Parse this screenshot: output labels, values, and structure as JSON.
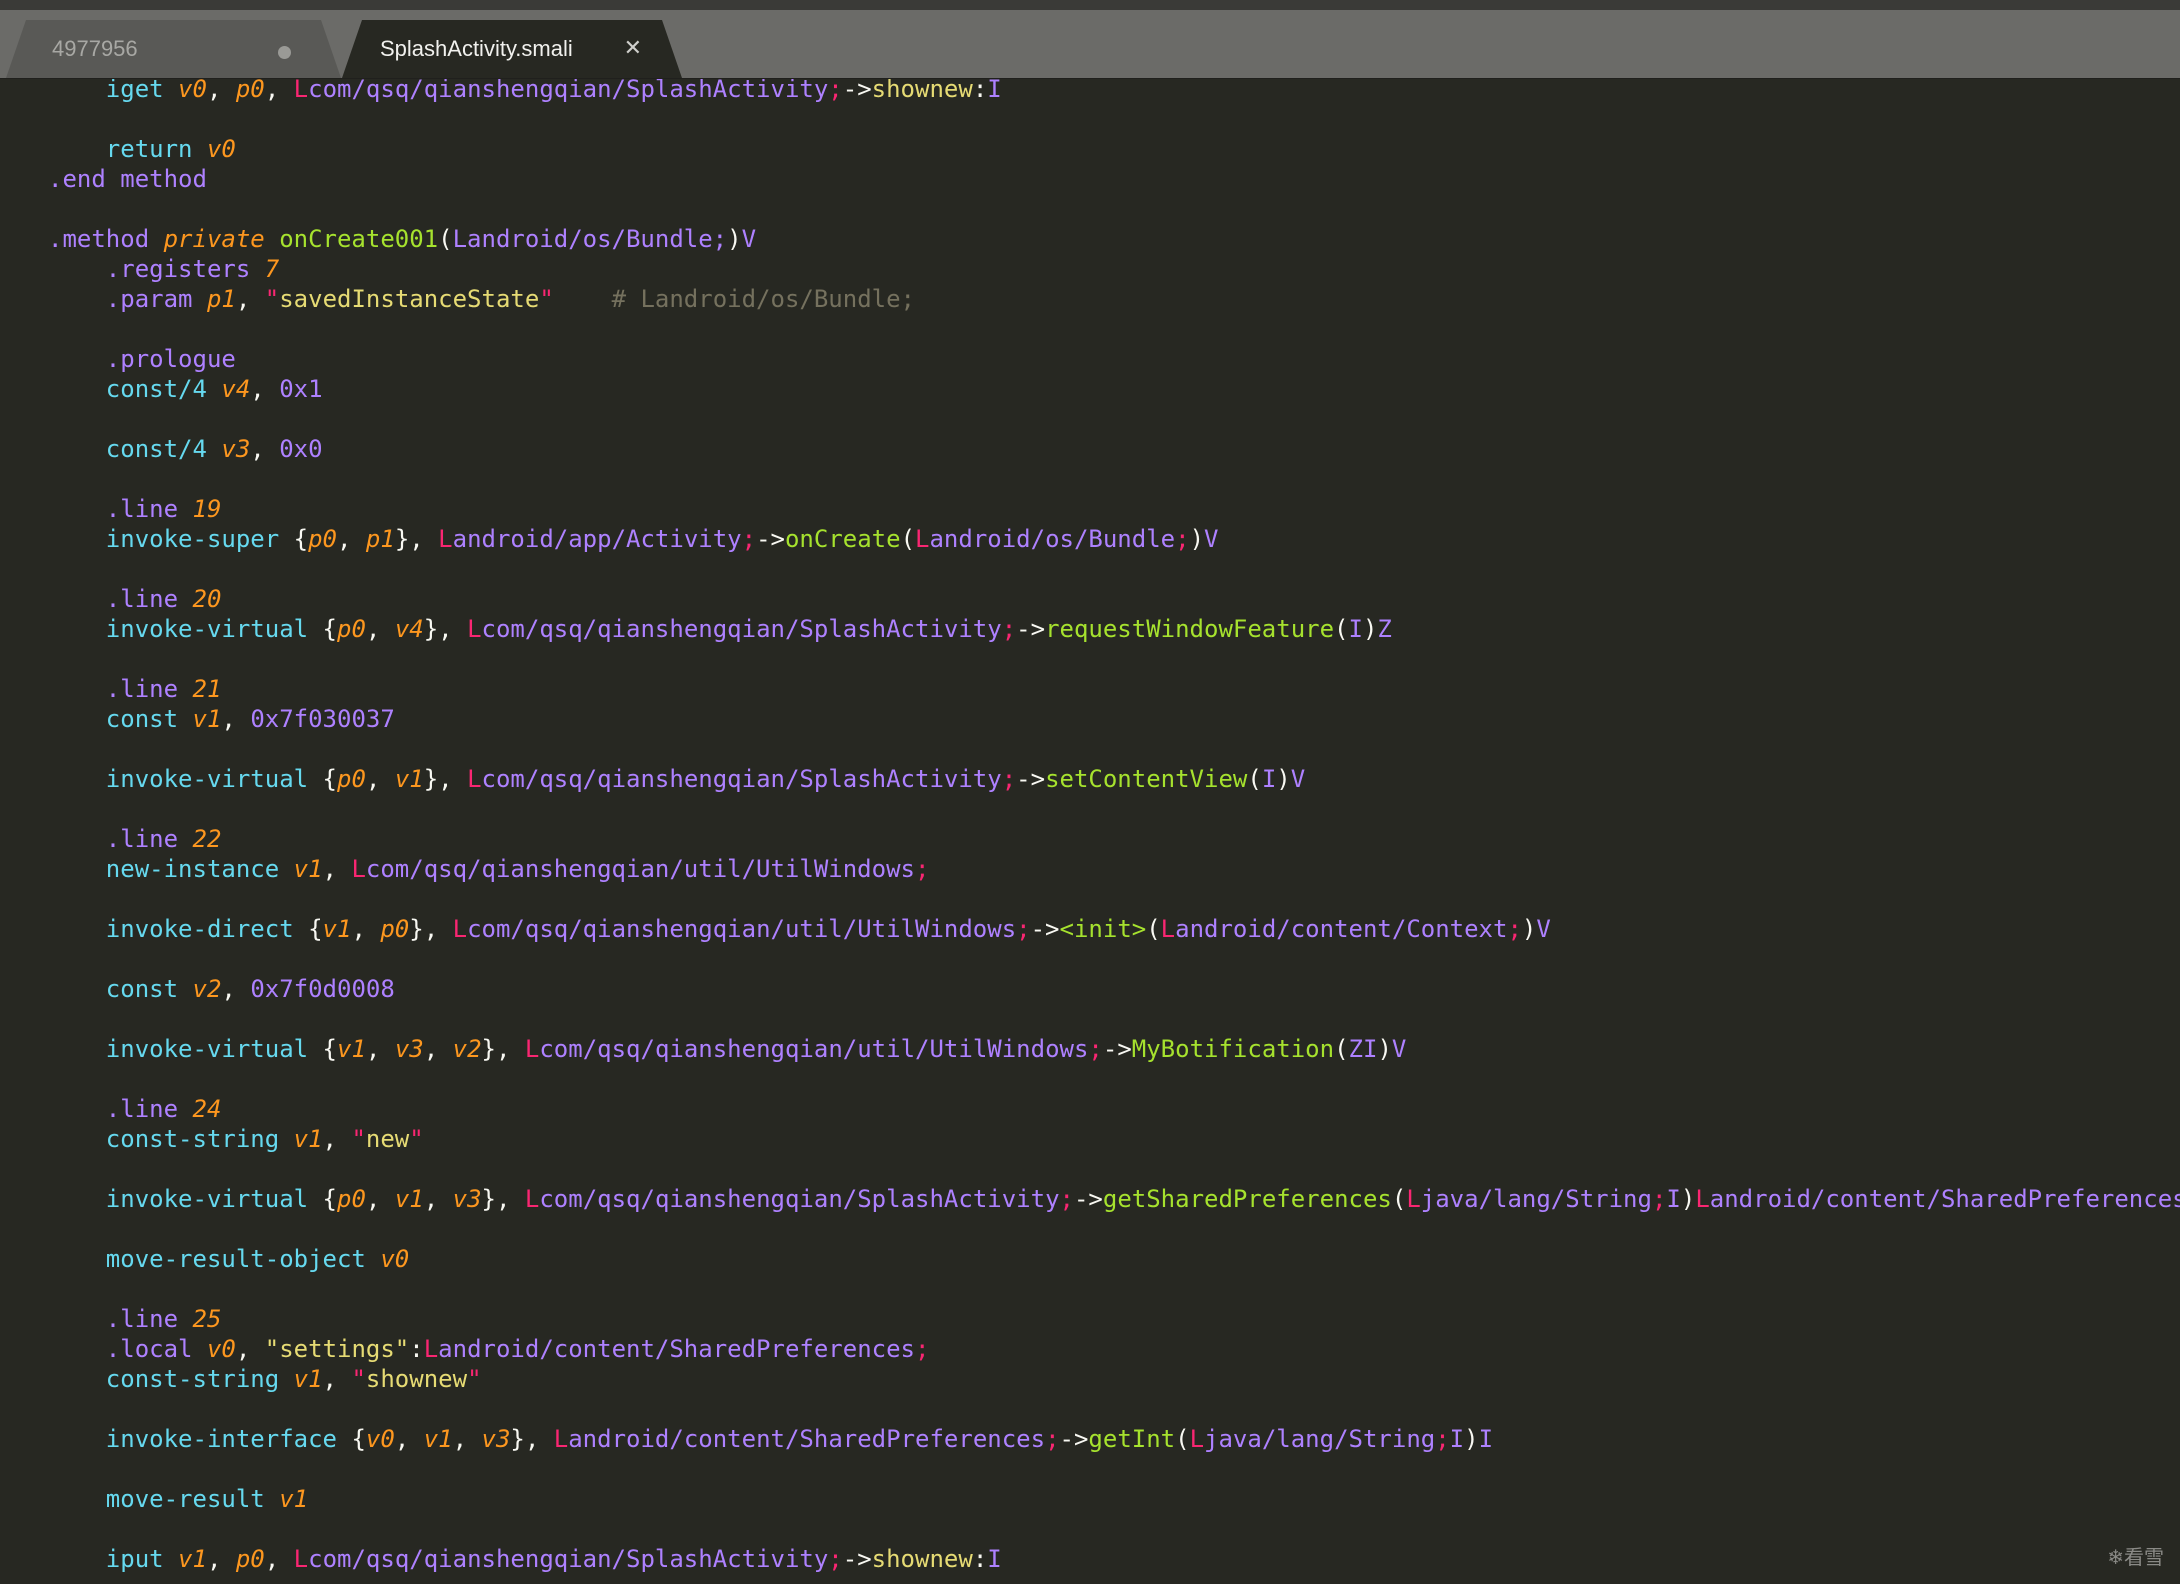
{
  "tabs": [
    {
      "label": "4977956",
      "active": false,
      "modified": true
    },
    {
      "label": "SplashActivity.smali",
      "active": true,
      "close_icon": "close-icon"
    }
  ],
  "colors": {
    "background": "#272822",
    "keyword": "#66d9ef",
    "directive": "#ae81ff",
    "register": "#fd971f",
    "string": "#e6db74",
    "class_prefix": "#f92672",
    "method_name": "#a6e22e",
    "comment": "#75715e"
  },
  "code_lines": [
    [
      [
        "kw",
        "    iget "
      ],
      [
        "reg",
        "v0"
      ],
      [
        "p",
        ", "
      ],
      [
        "reg",
        "p0"
      ],
      [
        "p",
        ", "
      ],
      [
        "L",
        "L"
      ],
      [
        "cls",
        "com/qsq/qianshengqian/SplashActivity"
      ],
      [
        "L",
        ";"
      ],
      [
        "p",
        "->"
      ],
      [
        "str",
        "shownew"
      ],
      [
        "p",
        ":"
      ],
      [
        "cls",
        "I"
      ]
    ],
    [],
    [
      [
        "kw",
        "    return "
      ],
      [
        "reg",
        "v0"
      ]
    ],
    [
      [
        "dir",
        ".end method"
      ]
    ],
    [],
    [
      [
        "dir",
        ".method "
      ],
      [
        "ikw",
        "private "
      ],
      [
        "m",
        "onCreate001"
      ],
      [
        "pr",
        "("
      ],
      [
        "cls",
        "Landroid/os/Bundle;"
      ],
      [
        "pr",
        ")"
      ],
      [
        "cls",
        "V"
      ]
    ],
    [
      [
        "dir",
        "    .registers "
      ],
      [
        "reg",
        "7"
      ]
    ],
    [
      [
        "dir",
        "    .param "
      ],
      [
        "reg",
        "p1"
      ],
      [
        "p",
        ", "
      ],
      [
        "q",
        "\""
      ],
      [
        "str",
        "savedInstanceState"
      ],
      [
        "q",
        "\""
      ],
      [
        "cmt",
        "    # Landroid/os/Bundle;"
      ]
    ],
    [],
    [
      [
        "dir",
        "    .prologue"
      ]
    ],
    [
      [
        "kw",
        "    const/4 "
      ],
      [
        "reg",
        "v4"
      ],
      [
        "p",
        ", "
      ],
      [
        "num",
        "0x1"
      ]
    ],
    [],
    [
      [
        "kw",
        "    const/4 "
      ],
      [
        "reg",
        "v3"
      ],
      [
        "p",
        ", "
      ],
      [
        "num",
        "0x0"
      ]
    ],
    [],
    [
      [
        "dir",
        "    .line "
      ],
      [
        "reg",
        "19"
      ]
    ],
    [
      [
        "kw",
        "    invoke-super "
      ],
      [
        "p",
        "{"
      ],
      [
        "reg",
        "p0"
      ],
      [
        "p",
        ", "
      ],
      [
        "reg",
        "p1"
      ],
      [
        "p",
        "}, "
      ],
      [
        "L",
        "L"
      ],
      [
        "cls",
        "android/app/Activity"
      ],
      [
        "L",
        ";"
      ],
      [
        "p",
        "->"
      ],
      [
        "m",
        "onCreate"
      ],
      [
        "pr",
        "("
      ],
      [
        "L",
        "L"
      ],
      [
        "cls",
        "android/os/Bundle"
      ],
      [
        "L",
        ";"
      ],
      [
        "pr",
        ")"
      ],
      [
        "cls",
        "V"
      ]
    ],
    [],
    [
      [
        "dir",
        "    .line "
      ],
      [
        "reg",
        "20"
      ]
    ],
    [
      [
        "kw",
        "    invoke-virtual "
      ],
      [
        "p",
        "{"
      ],
      [
        "reg",
        "p0"
      ],
      [
        "p",
        ", "
      ],
      [
        "reg",
        "v4"
      ],
      [
        "p",
        "}, "
      ],
      [
        "L",
        "L"
      ],
      [
        "cls",
        "com/qsq/qianshengqian/SplashActivity"
      ],
      [
        "L",
        ";"
      ],
      [
        "p",
        "->"
      ],
      [
        "m",
        "requestWindowFeature"
      ],
      [
        "pr",
        "("
      ],
      [
        "cls",
        "I"
      ],
      [
        "pr",
        ")"
      ],
      [
        "cls",
        "Z"
      ]
    ],
    [],
    [
      [
        "dir",
        "    .line "
      ],
      [
        "reg",
        "21"
      ]
    ],
    [
      [
        "kw",
        "    const "
      ],
      [
        "reg",
        "v1"
      ],
      [
        "p",
        ", "
      ],
      [
        "num",
        "0x7f030037"
      ]
    ],
    [],
    [
      [
        "kw",
        "    invoke-virtual "
      ],
      [
        "p",
        "{"
      ],
      [
        "reg",
        "p0"
      ],
      [
        "p",
        ", "
      ],
      [
        "reg",
        "v1"
      ],
      [
        "p",
        "}, "
      ],
      [
        "L",
        "L"
      ],
      [
        "cls",
        "com/qsq/qianshengqian/SplashActivity"
      ],
      [
        "L",
        ";"
      ],
      [
        "p",
        "->"
      ],
      [
        "m",
        "setContentView"
      ],
      [
        "pr",
        "("
      ],
      [
        "cls",
        "I"
      ],
      [
        "pr",
        ")"
      ],
      [
        "cls",
        "V"
      ]
    ],
    [],
    [
      [
        "dir",
        "    .line "
      ],
      [
        "reg",
        "22"
      ]
    ],
    [
      [
        "kw",
        "    new-instance "
      ],
      [
        "reg",
        "v1"
      ],
      [
        "p",
        ", "
      ],
      [
        "L",
        "L"
      ],
      [
        "cls",
        "com/qsq/qianshengqian/util/UtilWindows"
      ],
      [
        "L",
        ";"
      ]
    ],
    [],
    [
      [
        "kw",
        "    invoke-direct "
      ],
      [
        "p",
        "{"
      ],
      [
        "reg",
        "v1"
      ],
      [
        "p",
        ", "
      ],
      [
        "reg",
        "p0"
      ],
      [
        "p",
        "}, "
      ],
      [
        "L",
        "L"
      ],
      [
        "cls",
        "com/qsq/qianshengqian/util/UtilWindows"
      ],
      [
        "L",
        ";"
      ],
      [
        "p",
        "->"
      ],
      [
        "m",
        "<init>"
      ],
      [
        "pr",
        "("
      ],
      [
        "L",
        "L"
      ],
      [
        "cls",
        "android/content/Context"
      ],
      [
        "L",
        ";"
      ],
      [
        "pr",
        ")"
      ],
      [
        "cls",
        "V"
      ]
    ],
    [],
    [
      [
        "kw",
        "    const "
      ],
      [
        "reg",
        "v2"
      ],
      [
        "p",
        ", "
      ],
      [
        "num",
        "0x7f0d0008"
      ]
    ],
    [],
    [
      [
        "kw",
        "    invoke-virtual "
      ],
      [
        "p",
        "{"
      ],
      [
        "reg",
        "v1"
      ],
      [
        "p",
        ", "
      ],
      [
        "reg",
        "v3"
      ],
      [
        "p",
        ", "
      ],
      [
        "reg",
        "v2"
      ],
      [
        "p",
        "}, "
      ],
      [
        "L",
        "L"
      ],
      [
        "cls",
        "com/qsq/qianshengqian/util/UtilWindows"
      ],
      [
        "L",
        ";"
      ],
      [
        "p",
        "->"
      ],
      [
        "m",
        "MyBotification"
      ],
      [
        "pr",
        "("
      ],
      [
        "cls",
        "ZI"
      ],
      [
        "pr",
        ")"
      ],
      [
        "cls",
        "V"
      ]
    ],
    [],
    [
      [
        "dir",
        "    .line "
      ],
      [
        "reg",
        "24"
      ]
    ],
    [
      [
        "kw",
        "    const-string "
      ],
      [
        "reg",
        "v1"
      ],
      [
        "p",
        ", "
      ],
      [
        "q",
        "\""
      ],
      [
        "str",
        "new"
      ],
      [
        "q",
        "\""
      ]
    ],
    [],
    [
      [
        "kw",
        "    invoke-virtual "
      ],
      [
        "p",
        "{"
      ],
      [
        "reg",
        "p0"
      ],
      [
        "p",
        ", "
      ],
      [
        "reg",
        "v1"
      ],
      [
        "p",
        ", "
      ],
      [
        "reg",
        "v3"
      ],
      [
        "p",
        "}, "
      ],
      [
        "L",
        "L"
      ],
      [
        "cls",
        "com/qsq/qianshengqian/SplashActivity"
      ],
      [
        "L",
        ";"
      ],
      [
        "p",
        "->"
      ],
      [
        "m",
        "getSharedPreferences"
      ],
      [
        "pr",
        "("
      ],
      [
        "L",
        "L"
      ],
      [
        "cls",
        "java/lang/String"
      ],
      [
        "L",
        ";"
      ],
      [
        "cls",
        "I"
      ],
      [
        "pr",
        ")"
      ],
      [
        "L",
        "L"
      ],
      [
        "cls",
        "android/content/SharedPreferences"
      ],
      [
        "L",
        ";"
      ]
    ],
    [],
    [
      [
        "kw",
        "    move-result-object "
      ],
      [
        "reg",
        "v0"
      ]
    ],
    [],
    [
      [
        "dir",
        "    .line "
      ],
      [
        "reg",
        "25"
      ]
    ],
    [
      [
        "dir",
        "    .local "
      ],
      [
        "reg",
        "v0"
      ],
      [
        "p",
        ", "
      ],
      [
        "str",
        "\"settings\""
      ],
      [
        "p",
        ":"
      ],
      [
        "L",
        "L"
      ],
      [
        "cls",
        "android/content/SharedPreferences"
      ],
      [
        "L",
        ";"
      ]
    ],
    [
      [
        "kw",
        "    const-string "
      ],
      [
        "reg",
        "v1"
      ],
      [
        "p",
        ", "
      ],
      [
        "q",
        "\""
      ],
      [
        "str",
        "shownew"
      ],
      [
        "q",
        "\""
      ]
    ],
    [],
    [
      [
        "kw",
        "    invoke-interface "
      ],
      [
        "p",
        "{"
      ],
      [
        "reg",
        "v0"
      ],
      [
        "p",
        ", "
      ],
      [
        "reg",
        "v1"
      ],
      [
        "p",
        ", "
      ],
      [
        "reg",
        "v3"
      ],
      [
        "p",
        "}, "
      ],
      [
        "L",
        "L"
      ],
      [
        "cls",
        "android/content/SharedPreferences"
      ],
      [
        "L",
        ";"
      ],
      [
        "p",
        "->"
      ],
      [
        "m",
        "getInt"
      ],
      [
        "pr",
        "("
      ],
      [
        "L",
        "L"
      ],
      [
        "cls",
        "java/lang/String"
      ],
      [
        "L",
        ";"
      ],
      [
        "cls",
        "I"
      ],
      [
        "pr",
        ")"
      ],
      [
        "cls",
        "I"
      ]
    ],
    [],
    [
      [
        "kw",
        "    move-result "
      ],
      [
        "reg",
        "v1"
      ]
    ],
    [],
    [
      [
        "kw",
        "    iput "
      ],
      [
        "reg",
        "v1"
      ],
      [
        "p",
        ", "
      ],
      [
        "reg",
        "p0"
      ],
      [
        "p",
        ", "
      ],
      [
        "L",
        "L"
      ],
      [
        "cls",
        "com/qsq/qianshengqian/SplashActivity"
      ],
      [
        "L",
        ";"
      ],
      [
        "p",
        "->"
      ],
      [
        "str",
        "shownew"
      ],
      [
        "p",
        ":"
      ],
      [
        "cls",
        "I"
      ]
    ]
  ],
  "watermark": "❄看雪"
}
